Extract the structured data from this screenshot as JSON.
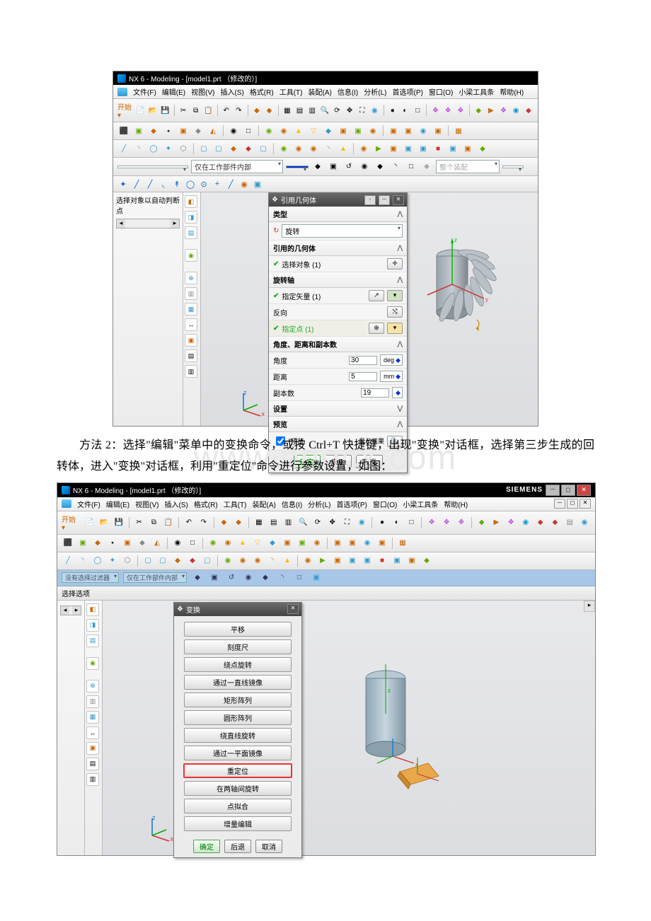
{
  "paragraph1": "方法 2：选择\"编辑\"菜单中的变换命令，或按 Ctrl+T 快捷键，出现\"变换\"对话框，选择第三步生成的回转体，进入\"变换\"对话框，利用\"重定位\"命令进行参数设置，如图：",
  "watermark": "www.bdocx.com",
  "app1": {
    "title": "NX 6 - Modeling - [model1.prt （修改的）]",
    "brand": "",
    "menubar": [
      "文件(F)",
      "编辑(E)",
      "视图(V)",
      "插入(S)",
      "格式(R)",
      "工具(T)",
      "装配(A)",
      "信息(I)",
      "分析(L)",
      "首选项(P)",
      "窗口(O)",
      "小梁工具条",
      "帮助(H)"
    ],
    "start": "开始 ▾",
    "selector_label": "仅在工作部件内部",
    "selector_right": "整个装配",
    "left_panel": "选择对象以自动判断点",
    "dialog": {
      "title": "引用几何体",
      "sec_type": "类型",
      "type_value": "旋转",
      "sec_geom": "引用的几何体",
      "row_select": "选择对象 (1)",
      "sec_axis": "旋转轴",
      "row_vector": "指定矢量 (1)",
      "row_reverse": "反向",
      "row_point": "指定点 (1)",
      "sec_params": "角度、距离和副本数",
      "p_angle_label": "角度",
      "p_angle_val": "30",
      "p_angle_unit": "deg",
      "p_dist_label": "距离",
      "p_dist_val": "5",
      "p_dist_unit": "mm",
      "p_copies_label": "副本数",
      "p_copies_val": "19",
      "sec_settings": "设置",
      "sec_preview": "预览",
      "chk_preview": "预览",
      "show_result": "显示结果",
      "btn_ok": "确定",
      "btn_apply": "应用",
      "btn_cancel": "取消"
    }
  },
  "app2": {
    "title": "NX 6 - Modeling - [model1.prt （修改的）]",
    "brand": "SIEMENS",
    "menubar": [
      "文件(F)",
      "编辑(E)",
      "视图(V)",
      "插入(S)",
      "格式(R)",
      "工具(T)",
      "装配(A)",
      "信息(I)",
      "分析(L)",
      "首选项(P)",
      "窗口(O)",
      "小梁工具条",
      "帮助(H)"
    ],
    "start": "开始 ▾",
    "blue_row_left": "没有选择过滤器",
    "blue_row_right": "仅在工作部件内部",
    "sub_header": "选择选项",
    "dialog": {
      "title": "变换",
      "items": [
        "平移",
        "刻度尺",
        "绕点旋转",
        "通过一直线镜像",
        "矩形阵列",
        "圆形阵列",
        "绕直线旋转",
        "通过一平面镜像",
        "重定位",
        "在两轴间旋转",
        "点拟合",
        "增量编辑"
      ],
      "hl_index": 8,
      "btn_ok": "确定",
      "btn_back": "后退",
      "btn_cancel": "取消"
    }
  }
}
